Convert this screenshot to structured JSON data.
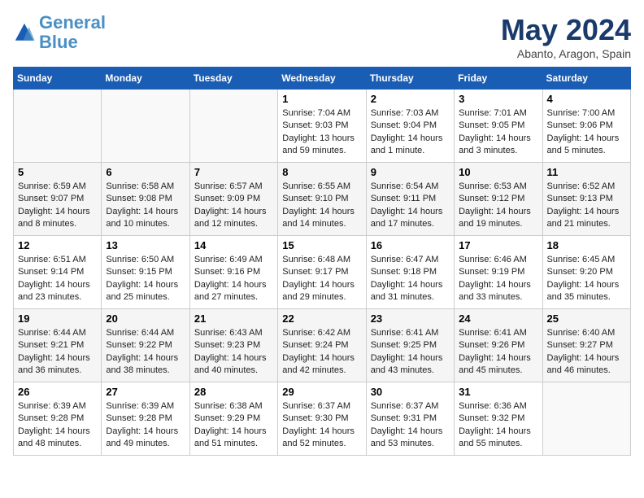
{
  "logo": {
    "line1": "General",
    "line2": "Blue"
  },
  "title": "May 2024",
  "subtitle": "Abanto, Aragon, Spain",
  "days_of_week": [
    "Sunday",
    "Monday",
    "Tuesday",
    "Wednesday",
    "Thursday",
    "Friday",
    "Saturday"
  ],
  "weeks": [
    [
      {
        "day": "",
        "info": ""
      },
      {
        "day": "",
        "info": ""
      },
      {
        "day": "",
        "info": ""
      },
      {
        "day": "1",
        "info": "Sunrise: 7:04 AM\nSunset: 9:03 PM\nDaylight: 13 hours and 59 minutes."
      },
      {
        "day": "2",
        "info": "Sunrise: 7:03 AM\nSunset: 9:04 PM\nDaylight: 14 hours and 1 minute."
      },
      {
        "day": "3",
        "info": "Sunrise: 7:01 AM\nSunset: 9:05 PM\nDaylight: 14 hours and 3 minutes."
      },
      {
        "day": "4",
        "info": "Sunrise: 7:00 AM\nSunset: 9:06 PM\nDaylight: 14 hours and 5 minutes."
      }
    ],
    [
      {
        "day": "5",
        "info": "Sunrise: 6:59 AM\nSunset: 9:07 PM\nDaylight: 14 hours and 8 minutes."
      },
      {
        "day": "6",
        "info": "Sunrise: 6:58 AM\nSunset: 9:08 PM\nDaylight: 14 hours and 10 minutes."
      },
      {
        "day": "7",
        "info": "Sunrise: 6:57 AM\nSunset: 9:09 PM\nDaylight: 14 hours and 12 minutes."
      },
      {
        "day": "8",
        "info": "Sunrise: 6:55 AM\nSunset: 9:10 PM\nDaylight: 14 hours and 14 minutes."
      },
      {
        "day": "9",
        "info": "Sunrise: 6:54 AM\nSunset: 9:11 PM\nDaylight: 14 hours and 17 minutes."
      },
      {
        "day": "10",
        "info": "Sunrise: 6:53 AM\nSunset: 9:12 PM\nDaylight: 14 hours and 19 minutes."
      },
      {
        "day": "11",
        "info": "Sunrise: 6:52 AM\nSunset: 9:13 PM\nDaylight: 14 hours and 21 minutes."
      }
    ],
    [
      {
        "day": "12",
        "info": "Sunrise: 6:51 AM\nSunset: 9:14 PM\nDaylight: 14 hours and 23 minutes."
      },
      {
        "day": "13",
        "info": "Sunrise: 6:50 AM\nSunset: 9:15 PM\nDaylight: 14 hours and 25 minutes."
      },
      {
        "day": "14",
        "info": "Sunrise: 6:49 AM\nSunset: 9:16 PM\nDaylight: 14 hours and 27 minutes."
      },
      {
        "day": "15",
        "info": "Sunrise: 6:48 AM\nSunset: 9:17 PM\nDaylight: 14 hours and 29 minutes."
      },
      {
        "day": "16",
        "info": "Sunrise: 6:47 AM\nSunset: 9:18 PM\nDaylight: 14 hours and 31 minutes."
      },
      {
        "day": "17",
        "info": "Sunrise: 6:46 AM\nSunset: 9:19 PM\nDaylight: 14 hours and 33 minutes."
      },
      {
        "day": "18",
        "info": "Sunrise: 6:45 AM\nSunset: 9:20 PM\nDaylight: 14 hours and 35 minutes."
      }
    ],
    [
      {
        "day": "19",
        "info": "Sunrise: 6:44 AM\nSunset: 9:21 PM\nDaylight: 14 hours and 36 minutes."
      },
      {
        "day": "20",
        "info": "Sunrise: 6:44 AM\nSunset: 9:22 PM\nDaylight: 14 hours and 38 minutes."
      },
      {
        "day": "21",
        "info": "Sunrise: 6:43 AM\nSunset: 9:23 PM\nDaylight: 14 hours and 40 minutes."
      },
      {
        "day": "22",
        "info": "Sunrise: 6:42 AM\nSunset: 9:24 PM\nDaylight: 14 hours and 42 minutes."
      },
      {
        "day": "23",
        "info": "Sunrise: 6:41 AM\nSunset: 9:25 PM\nDaylight: 14 hours and 43 minutes."
      },
      {
        "day": "24",
        "info": "Sunrise: 6:41 AM\nSunset: 9:26 PM\nDaylight: 14 hours and 45 minutes."
      },
      {
        "day": "25",
        "info": "Sunrise: 6:40 AM\nSunset: 9:27 PM\nDaylight: 14 hours and 46 minutes."
      }
    ],
    [
      {
        "day": "26",
        "info": "Sunrise: 6:39 AM\nSunset: 9:28 PM\nDaylight: 14 hours and 48 minutes."
      },
      {
        "day": "27",
        "info": "Sunrise: 6:39 AM\nSunset: 9:28 PM\nDaylight: 14 hours and 49 minutes."
      },
      {
        "day": "28",
        "info": "Sunrise: 6:38 AM\nSunset: 9:29 PM\nDaylight: 14 hours and 51 minutes."
      },
      {
        "day": "29",
        "info": "Sunrise: 6:37 AM\nSunset: 9:30 PM\nDaylight: 14 hours and 52 minutes."
      },
      {
        "day": "30",
        "info": "Sunrise: 6:37 AM\nSunset: 9:31 PM\nDaylight: 14 hours and 53 minutes."
      },
      {
        "day": "31",
        "info": "Sunrise: 6:36 AM\nSunset: 9:32 PM\nDaylight: 14 hours and 55 minutes."
      },
      {
        "day": "",
        "info": ""
      }
    ]
  ]
}
